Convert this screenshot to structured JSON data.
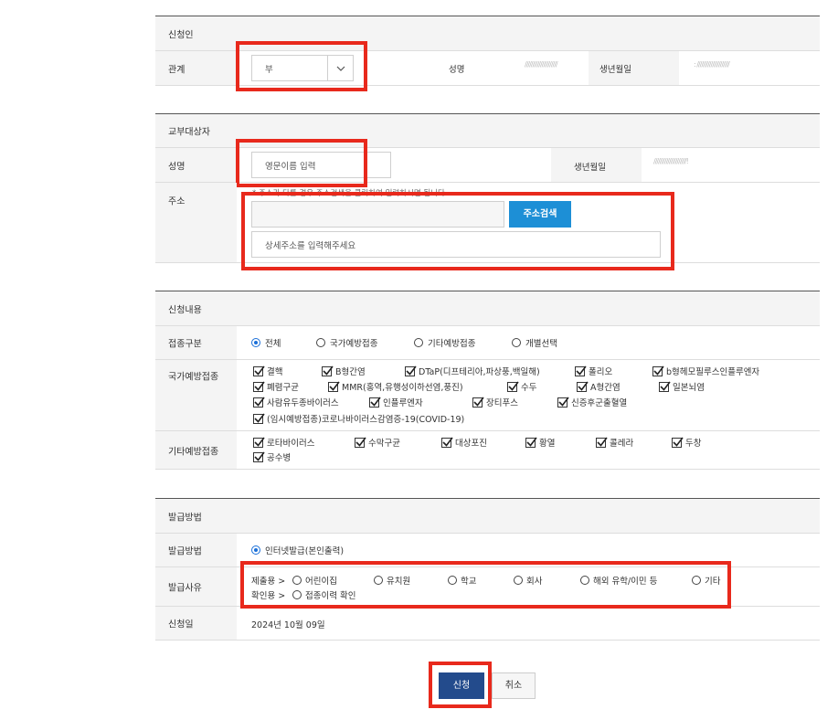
{
  "applicant": {
    "section_title": "신청인",
    "relation_label": "관계",
    "relation_value": "부",
    "name_label": "성명",
    "name_masked": "/////////////////////",
    "birth_label": "생년월일",
    "birth_masked": ": /////////////////////"
  },
  "recipient": {
    "section_title": "교부대상자",
    "name_label": "성명",
    "name_placeholder": "영문이름 입력",
    "birth_label": "생년월일",
    "birth_masked": "/////////////////////!",
    "address_label": "주소",
    "address_note": "* 주소가 다를 경우 주소검색을 클릭하여 입력하시면 됩니다.",
    "address_search_button": "주소검색",
    "address_detail_placeholder": "상세주소를 입력해주세요"
  },
  "content": {
    "section_title": "신청내용",
    "type_label": "접종구분",
    "type_options": [
      "전체",
      "국가예방접종",
      "기타예방접종",
      "개별선택"
    ],
    "national_label": "국가예방접종",
    "national_items": [
      "결핵",
      "B형간염",
      "DTaP(디프테리아,파상풍,백일해)",
      "폴리오",
      "b형헤모필루스인플루엔자",
      "폐렴구균",
      "MMR(홍역,유행성이하선염,풍진)",
      "수두",
      "A형간염",
      "일본뇌염",
      "사람유두종바이러스",
      "인플루엔자",
      "장티푸스",
      "신증후군출혈열",
      "(임시예방접종)코로나바이러스감염증-19(COVID-19)"
    ],
    "other_label": "기타예방접종",
    "other_items": [
      "로타바이러스",
      "수막구균",
      "대상포진",
      "황열",
      "콜레라",
      "두창",
      "공수병"
    ]
  },
  "issue": {
    "section_title": "발급방법",
    "method_label": "발급방법",
    "method_value": "인터넷발급(본인출력)",
    "reason_label": "발급사유",
    "submit_prefix": "제출용 >",
    "submit_options": [
      "어린이집",
      "유치원",
      "학교",
      "회사",
      "해외 유학/이민 등",
      "기타"
    ],
    "confirm_prefix": "확인용 >",
    "confirm_options": [
      "접종이력 확인"
    ],
    "date_label": "신청일",
    "date_value": "2024년 10월 09일"
  },
  "buttons": {
    "apply": "신청",
    "cancel": "취소"
  },
  "colors": {
    "accent": "#1a6fd8",
    "primary_button": "#234b8c",
    "search_button": "#1d8fd6",
    "highlight": "#e8291c"
  }
}
